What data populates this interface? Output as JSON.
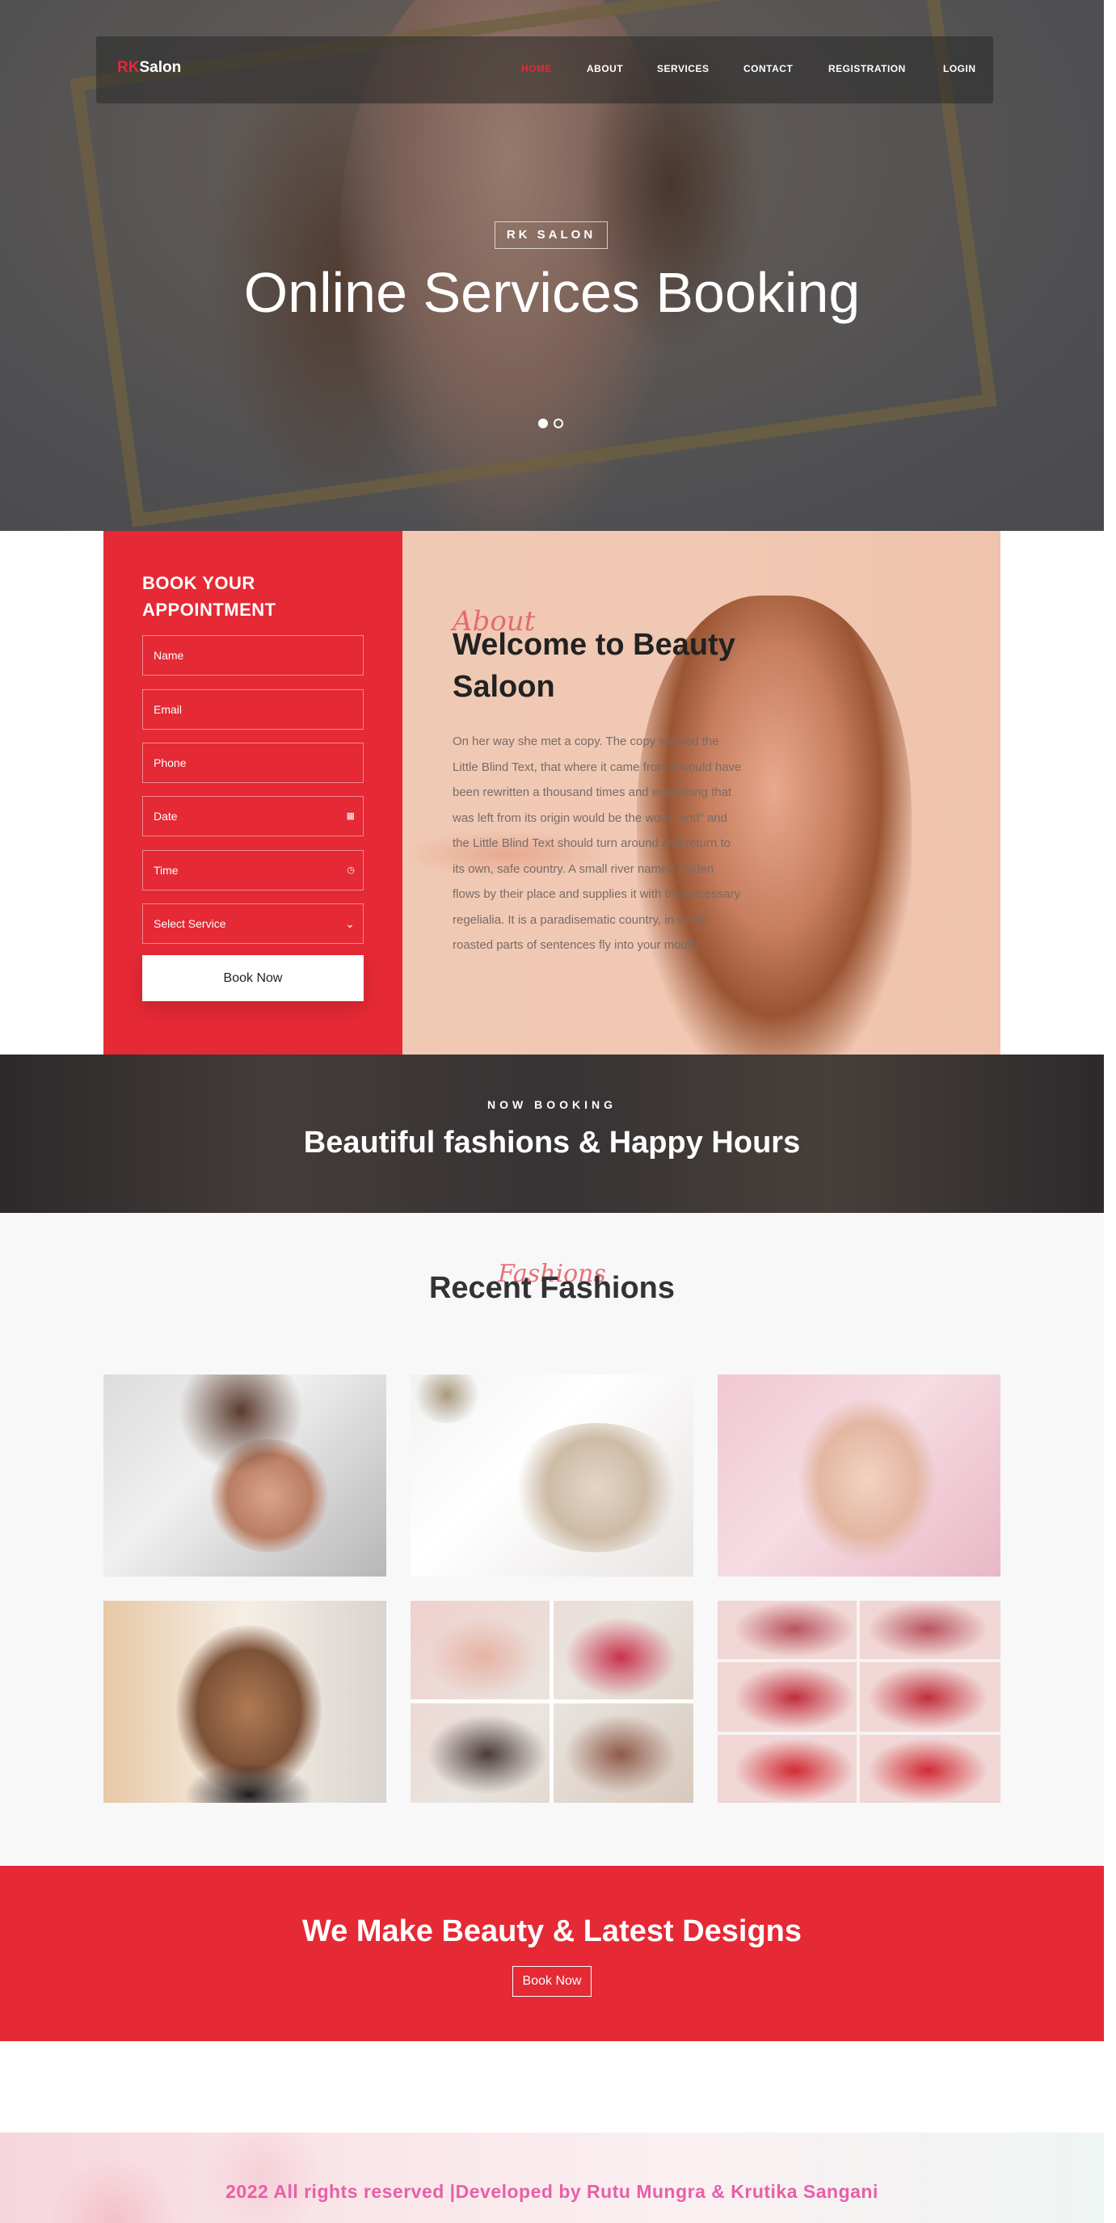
{
  "hero": {
    "brand_prefix": "RK",
    "brand_suffix": "Salon",
    "nav": [
      "HOME",
      "ABOUT",
      "SERVICES",
      "CONTACT",
      "REGISTRATION",
      "LOGIN"
    ],
    "tag": "RK SALON",
    "title": "Online Services Booking",
    "slides": 2,
    "active_slide": 1
  },
  "booking": {
    "title": "BOOK YOUR APPOINTMENT",
    "name_placeholder": "Name",
    "email_placeholder": "Email",
    "phone_placeholder": "Phone",
    "date_placeholder": "Date",
    "time_placeholder": "Time",
    "service_selected": "Select Service",
    "submit_label": "Book Now"
  },
  "about": {
    "subheading": "About",
    "title": "Welcome to Beauty Saloon",
    "text": "On her way she met a copy. The copy warned the Little Blind Text, that where it came from it would have been rewritten a thousand times and everything that was left from its origin would be the word \"and\" and the Little Blind Text should turn around and return to its own, safe country. A small river named Duden flows by their place and supplies it with the necessary regelialia. It is a paradisematic country, in which roasted parts of sentences fly into your mouth."
  },
  "banner": {
    "kicker": "NOW BOOKING",
    "title": "Beautiful fashions & Happy Hours"
  },
  "fashions": {
    "subheading": "Fashions",
    "title": "Recent Fashions",
    "tiles": [
      "eyebrow-treatment",
      "facial-mask",
      "face-treatment",
      "hair-styling",
      "nail-art",
      "lip-makeup"
    ]
  },
  "cta": {
    "title": "We Make Beauty & Latest Designs",
    "button_label": "Book Now"
  },
  "footer": {
    "text": "2022 All rights reserved |Developed by Rutu Mungra & Krutika Sangani"
  },
  "colors": {
    "accent": "#e52935",
    "footer_text": "#e85fa8",
    "about_bg": "#f0c9b4"
  }
}
